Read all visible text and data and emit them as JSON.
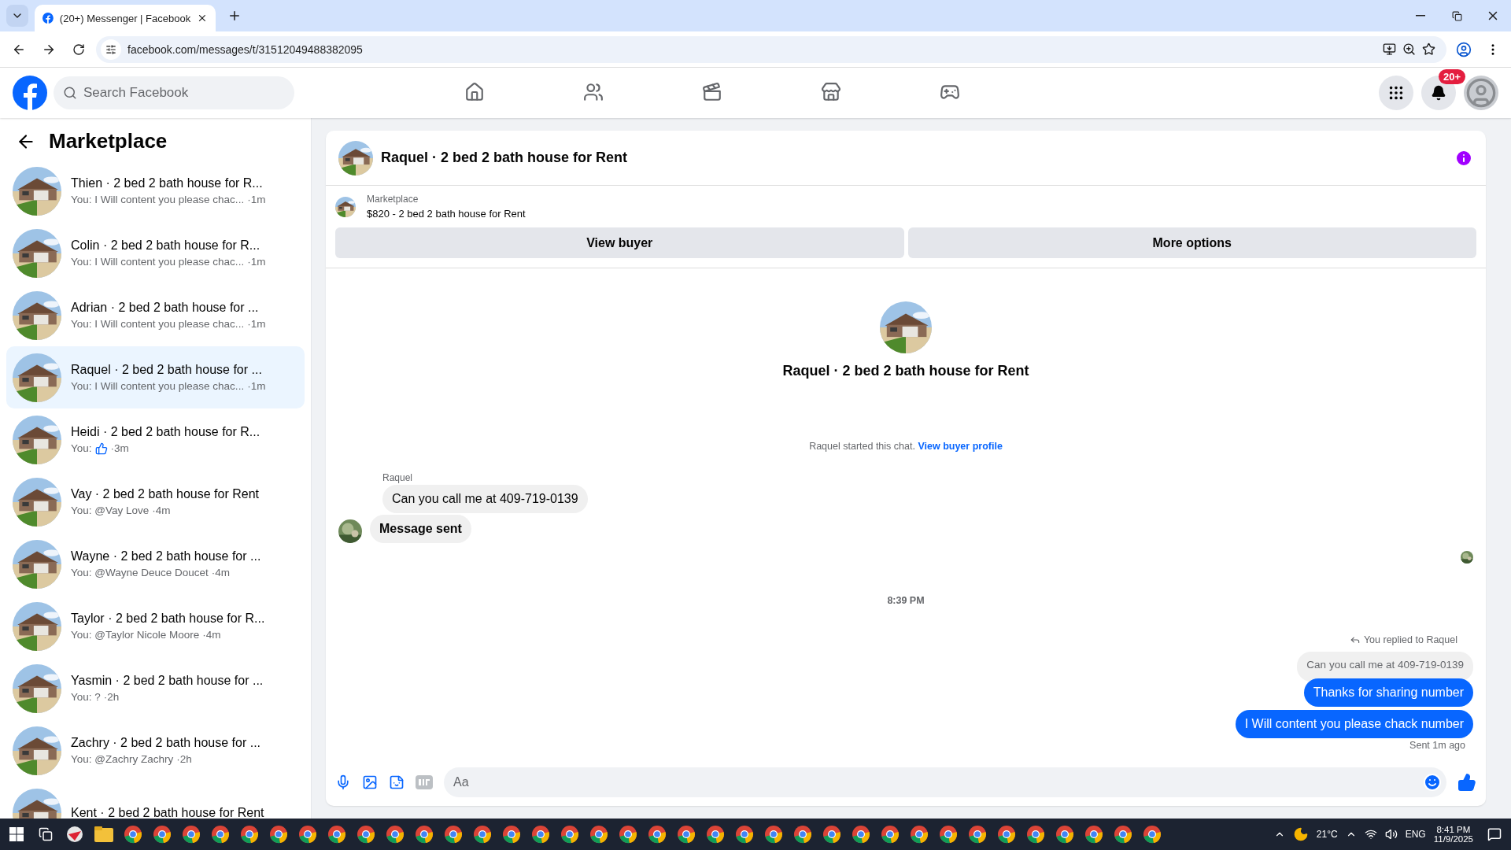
{
  "browser": {
    "tab_title": "(20+) Messenger | Facebook",
    "url": "facebook.com/messages/t/31512049488382095"
  },
  "header": {
    "search": {
      "placeholder": "Search Facebook"
    },
    "nav": [
      {
        "kind": "home",
        "selected": false
      },
      {
        "kind": "friends",
        "selected": false
      },
      {
        "kind": "video",
        "selected": false
      },
      {
        "kind": "marketplace",
        "selected": false
      },
      {
        "kind": "gaming",
        "selected": false
      }
    ],
    "notification_badge": "20+"
  },
  "sidebar": {
    "title": "Marketplace",
    "items": [
      {
        "title": "Thien · 2 bed 2 bath house for R...",
        "preview": "You: I Will content you please chac...",
        "time": "·1m",
        "kind": "text",
        "selected": false
      },
      {
        "title": "Colin · 2 bed 2 bath house for R...",
        "preview": "You: I Will content you please chac...",
        "time": "·1m",
        "kind": "text",
        "selected": false
      },
      {
        "title": "Adrian · 2 bed 2 bath house for ...",
        "preview": "You: I Will content you please chac...",
        "time": "·1m",
        "kind": "text",
        "selected": false
      },
      {
        "title": "Raquel · 2 bed 2 bath house for ...",
        "preview": "You: I Will content you please chac...",
        "time": "·1m",
        "kind": "text",
        "selected": true
      },
      {
        "title": "Heidi · 2 bed 2 bath house for R...",
        "preview": "You:",
        "time": "·3m",
        "kind": "like",
        "selected": false
      },
      {
        "title": "Vay · 2 bed 2 bath house for Rent",
        "preview": "You: @Vay Love",
        "time": "·4m",
        "kind": "text",
        "selected": false
      },
      {
        "title": "Wayne · 2 bed 2 bath house for ...",
        "preview": "You: @Wayne Deuce Doucet",
        "time": "·4m",
        "kind": "text",
        "selected": false
      },
      {
        "title": "Taylor · 2 bed 2 bath house for R...",
        "preview": "You: @Taylor Nicole Moore",
        "time": "·4m",
        "kind": "text",
        "selected": false
      },
      {
        "title": "Yasmin · 2 bed 2 bath house for ...",
        "preview": "You: ?",
        "time": "·2h",
        "kind": "text",
        "selected": false
      },
      {
        "title": "Zachry · 2 bed 2 bath house for ...",
        "preview": "You: @Zachry Zachry",
        "time": "·2h",
        "kind": "text",
        "selected": false
      },
      {
        "title": "Kent · 2 bed 2 bath house for Rent",
        "kind": "title-only",
        "selected": false
      }
    ]
  },
  "chat": {
    "title": "Raquel · 2 bed 2 bath house for Rent",
    "listing": {
      "source": "Marketplace",
      "name": "$820 - 2 bed 2 bath house for Rent"
    },
    "buttons": [
      "View buyer",
      "More options"
    ],
    "intro": {
      "title": "Raquel · 2 bed 2 bath house for Rent",
      "started": "Raquel started this chat.",
      "link": "View buyer profile"
    },
    "sender": "Raquel",
    "messages": [
      {
        "kind": "incoming",
        "text": "Can you call me at 409-719-0139"
      },
      {
        "kind": "incoming-bold",
        "text": "Message sent"
      },
      {
        "kind": "seen"
      },
      {
        "kind": "time",
        "text": "8:39 PM"
      },
      {
        "kind": "reply-note",
        "text": "You replied to Raquel"
      },
      {
        "kind": "quote",
        "text": "Can you call me at 409-719-0139"
      },
      {
        "kind": "outgoing",
        "text": "Thanks for sharing number"
      },
      {
        "kind": "outgoing",
        "text": "I Will content you please chack number"
      },
      {
        "kind": "status",
        "text": "Sent 1m ago"
      }
    ],
    "composer": {
      "placeholder": "Aa"
    }
  },
  "taskbar": {
    "temperature": "21°C",
    "language": "ENG",
    "time": "8:41 PM",
    "date": "11/9/2025"
  }
}
